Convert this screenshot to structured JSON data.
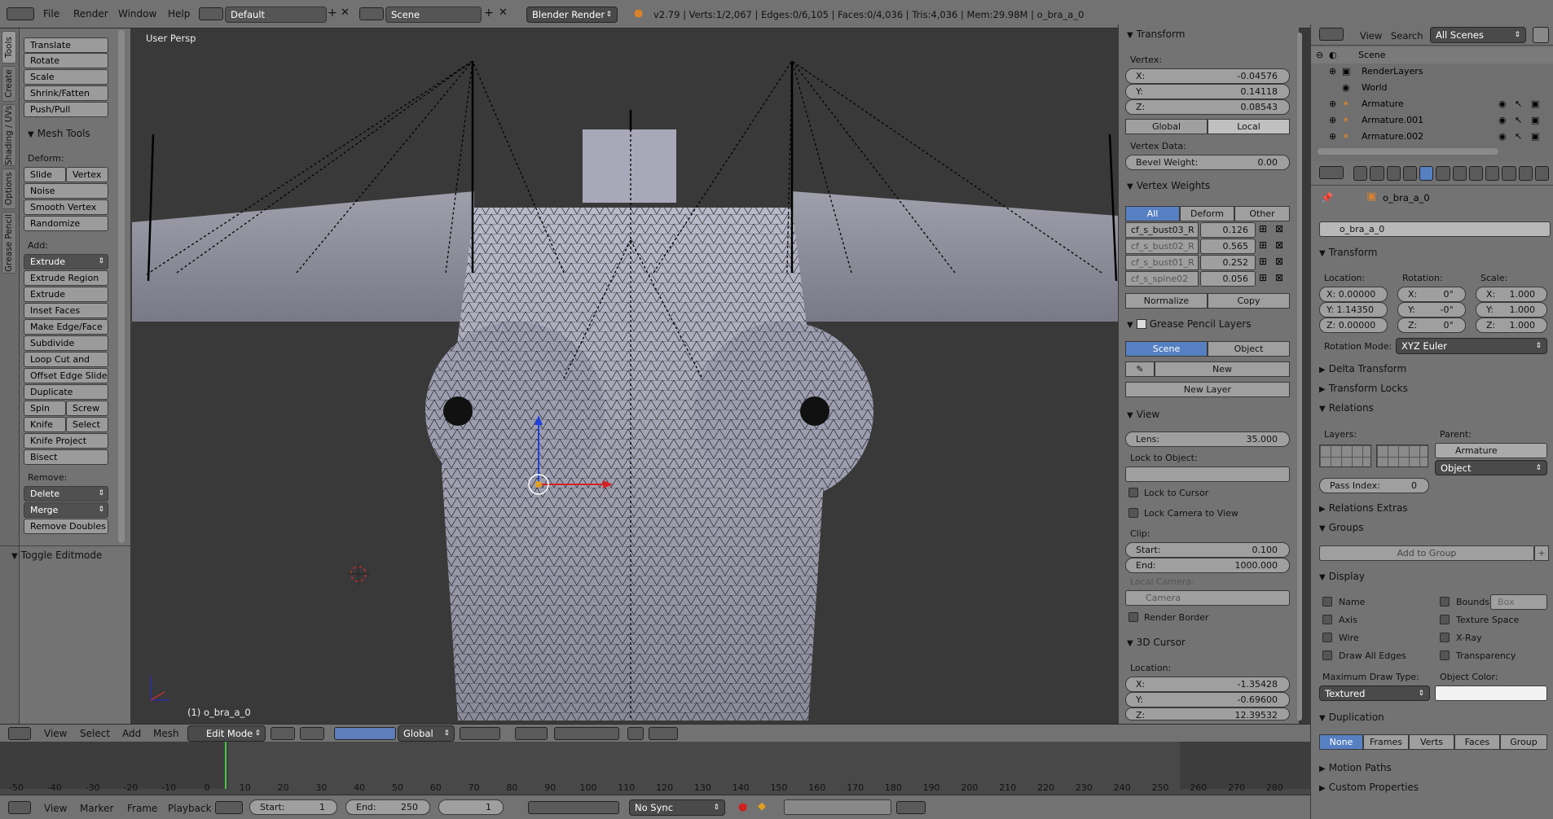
{
  "topbar": {
    "menus": [
      "File",
      "Render",
      "Window",
      "Help"
    ],
    "layout": "Default",
    "scene": "Scene",
    "engine": "Blender Render",
    "stats": "v2.79 | Verts:1/2,067 | Edges:0/6,105 | Faces:0/4,036 | Tris:4,036 | Mem:29.98M | o_bra_a_0"
  },
  "vtabs": [
    "Tools",
    "Create",
    "Shading / UVs",
    "Options",
    "Grease Pencil"
  ],
  "toolshelf": {
    "transform_buttons": [
      "Translate",
      "Rotate",
      "Scale",
      "Shrink/Fatten",
      "Push/Pull"
    ],
    "mesh_tools_title": "Mesh Tools",
    "deform_label": "Deform:",
    "slide_edge": "Slide Ed",
    "vertex": "Vertex",
    "noise": "Noise",
    "smooth_vertex": "Smooth Vertex",
    "randomize": "Randomize",
    "add_label": "Add:",
    "extrude": "Extrude",
    "add_buttons": [
      "Extrude Region",
      "Extrude Individual",
      "Inset Faces",
      "Make Edge/Face",
      "Subdivide",
      "Loop Cut and Slide",
      "Offset Edge Slide",
      "Duplicate"
    ],
    "spin": "Spin",
    "screw": "Screw",
    "knife": "Knife",
    "select": "Select",
    "knife_project": "Knife Project",
    "bisect": "Bisect",
    "remove_label": "Remove:",
    "delete": "Delete",
    "merge": "Merge",
    "remove_doubles": "Remove Doubles",
    "toggle_editmode": "Toggle Editmode"
  },
  "viewport": {
    "label": "User Persp",
    "object_label": "(1) o_bra_a_0"
  },
  "npanel": {
    "transform_title": "Transform",
    "vertex_label": "Vertex:",
    "vx": "-0.04576",
    "vy": "0.14118",
    "vz": "0.08543",
    "global": "Global",
    "local": "Local",
    "vertex_data": "Vertex Data:",
    "bevel_weight_label": "Bevel Weight:",
    "bevel_weight": "0.00",
    "vweights_title": "Vertex Weights",
    "vw_tabs": [
      "All",
      "Deform",
      "Other"
    ],
    "weights": [
      {
        "name": "cf_s_bust03_R",
        "value": "0.126"
      },
      {
        "name": "cf_s_bust02_R",
        "value": "0.565"
      },
      {
        "name": "cf_s_bust01_R",
        "value": "0.252"
      },
      {
        "name": "cf_s_spine02",
        "value": "0.056"
      }
    ],
    "normalize": "Normalize",
    "copy": "Copy",
    "gp_title": "Grease Pencil Layers",
    "gp_scene": "Scene",
    "gp_object": "Object",
    "new": "New",
    "new_layer": "New Layer",
    "view_title": "View",
    "lens_label": "Lens:",
    "lens": "35.000",
    "lock_to_object": "Lock to Object:",
    "lock_cursor": "Lock to Cursor",
    "lock_camera": "Lock Camera to View",
    "clip_label": "Clip:",
    "start_label": "Start:",
    "start": "0.100",
    "end_label": "End:",
    "end": "1000.000",
    "local_camera": "Local Camera:",
    "camera": "Camera",
    "render_border": "Render Border",
    "cursor_title": "3D Cursor",
    "location_label": "Location:",
    "cx": "-1.35428",
    "cy": "-0.69600",
    "cz": "12.39532"
  },
  "outliner": {
    "view": "View",
    "search": "Search",
    "scenes": "All Scenes",
    "rows": [
      "Scene",
      "RenderLayers",
      "World",
      "Armature",
      "Armature.001",
      "Armature.002"
    ]
  },
  "props": {
    "object_name_crumb": "o_bra_a_0",
    "object_name": "o_bra_a_0",
    "transform_title": "Transform",
    "location_label": "Location:",
    "rotation_label": "Rotation:",
    "scale_label": "Scale:",
    "loc": [
      "X: 0.00000",
      "Y: 1.14350",
      "Z: 0.00000"
    ],
    "rot_axes": [
      "X:",
      "Y:",
      "Z:"
    ],
    "rot_vals": [
      "0°",
      "-0°",
      "0°"
    ],
    "scale_axes": [
      "X:",
      "Y:",
      "Z:"
    ],
    "scale_vals": [
      "1.000",
      "1.000",
      "1.000"
    ],
    "rotation_mode_label": "Rotation Mode:",
    "rotation_mode": "XYZ Euler",
    "delta_transform": "Delta Transform",
    "transform_locks": "Transform Locks",
    "relations": "Relations",
    "layers_label": "Layers:",
    "parent_label": "Parent:",
    "parent": "Armature",
    "parent_type": "Object",
    "pass_index_label": "Pass Index:",
    "pass_index": "0",
    "relations_extras": "Relations Extras",
    "groups": "Groups",
    "add_to_group": "Add to Group",
    "display": "Display",
    "name": "Name",
    "bounds": "Bounds",
    "box": "Box",
    "axis": "Axis",
    "texture_space": "Texture Space",
    "wire": "Wire",
    "xray": "X-Ray",
    "draw_all_edges": "Draw All Edges",
    "transparency": "Transparency",
    "max_draw_type_label": "Maximum Draw Type:",
    "object_color_label": "Object Color:",
    "max_draw_type": "Textured",
    "duplication": "Duplication",
    "dup_tabs": [
      "None",
      "Frames",
      "Verts",
      "Faces",
      "Group"
    ],
    "motion_paths": "Motion Paths",
    "custom_properties": "Custom Properties"
  },
  "vpheader": {
    "menus": [
      "View",
      "Select",
      "Add",
      "Mesh"
    ],
    "mode": "Edit Mode",
    "orientation": "Global"
  },
  "timeline": {
    "ticks": [
      "-50",
      "-40",
      "-30",
      "-20",
      "-10",
      "0",
      "10",
      "20",
      "30",
      "40",
      "50",
      "60",
      "70",
      "80",
      "90",
      "100",
      "110",
      "120",
      "130",
      "140",
      "150",
      "160",
      "170",
      "180",
      "190",
      "200",
      "210",
      "220",
      "230",
      "240",
      "250",
      "260",
      "270",
      "280"
    ],
    "menus": [
      "View",
      "Marker",
      "Frame",
      "Playback"
    ],
    "start_label": "Start:",
    "start": "1",
    "end_label": "End:",
    "end": "250",
    "current": "1",
    "sync": "No Sync"
  }
}
